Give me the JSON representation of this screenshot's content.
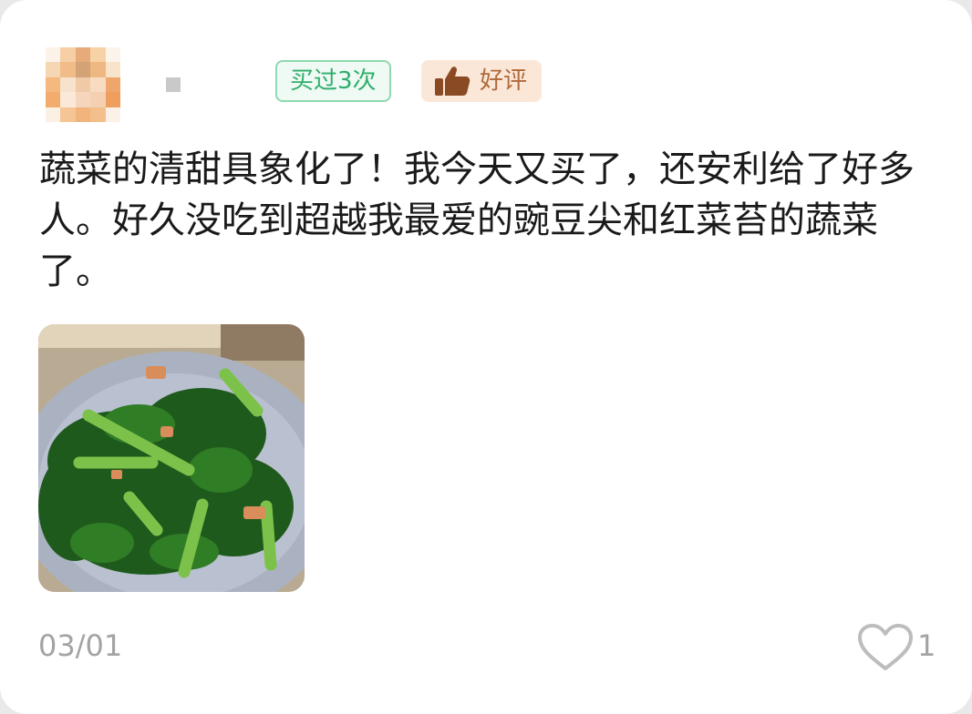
{
  "review": {
    "badge_purchase": "买过3次",
    "badge_rating": "好评",
    "text": "蔬菜的清甜具象化了！我今天又买了，还安利给了好多人。好久没吃到超越我最爱的豌豆尖和红菜苔的蔬菜了。",
    "date": "03/01",
    "like_count": "1",
    "colors": {
      "accent_green": "#2fae6b",
      "rating_brown": "#b06a3a",
      "muted_text": "#a3a3a3"
    },
    "icons": [
      "avatar",
      "thumbs-up-icon",
      "heart-icon"
    ]
  }
}
